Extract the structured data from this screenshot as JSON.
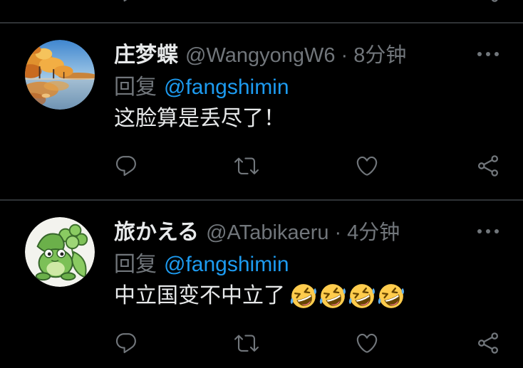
{
  "theme": {
    "background": "#000000",
    "primary_text": "#e7e9ea",
    "secondary_text": "#71767b",
    "link": "#1d9bf0",
    "divider": "#2f3336"
  },
  "previous_tweet": {
    "action_icons": [
      "reply-icon",
      "share-icon"
    ]
  },
  "tweets": [
    {
      "avatar_icon": "autumn-trees-reflection-avatar",
      "display_name": "庄梦蝶",
      "handle": "@WangyongW6",
      "separator": "·",
      "time": "8分钟",
      "menu_icon": "more-horizontal-icon",
      "reply_label": "回复",
      "reply_to": "@fangshimin",
      "text": "这脸算是丢尽了！",
      "action_icons": [
        "reply-icon",
        "retweet-icon",
        "heart-icon",
        "share-icon"
      ]
    },
    {
      "avatar_icon": "travel-frog-avatar",
      "display_name": "旅かえる",
      "handle": "@ATabikaeru",
      "separator": "·",
      "time": "4分钟",
      "menu_icon": "more-horizontal-icon",
      "reply_label": "回复",
      "reply_to": "@fangshimin",
      "text": "中立国变不中立了",
      "emoji": [
        "🤣",
        "🤣",
        "🤣",
        "🤣"
      ],
      "emoji_icon": "rolling-on-the-floor-laughing-emoji",
      "action_icons": [
        "reply-icon",
        "retweet-icon",
        "heart-icon",
        "share-icon"
      ]
    }
  ]
}
